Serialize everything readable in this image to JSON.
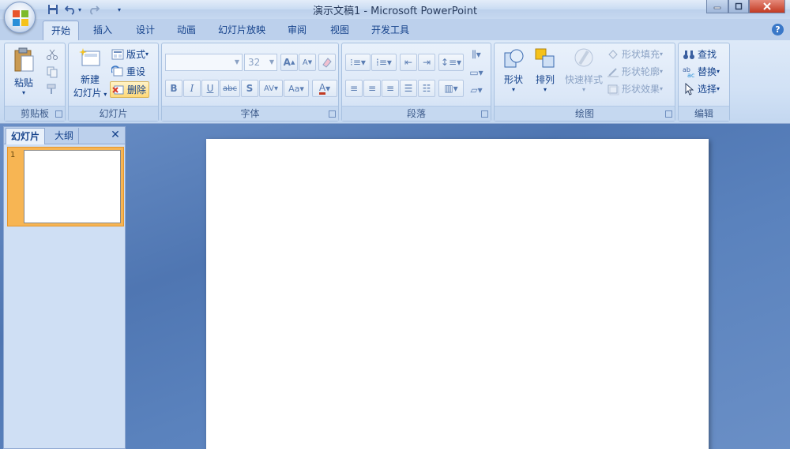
{
  "window": {
    "title": "演示文稿1 - Microsoft PowerPoint",
    "buttons": [
      "minimize",
      "maximize",
      "close"
    ]
  },
  "tabs": [
    {
      "label": "开始",
      "active": true
    },
    {
      "label": "插入"
    },
    {
      "label": "设计"
    },
    {
      "label": "动画"
    },
    {
      "label": "幻灯片放映"
    },
    {
      "label": "审阅"
    },
    {
      "label": "视图"
    },
    {
      "label": "开发工具"
    }
  ],
  "ribbon": {
    "clipboard": {
      "label": "剪贴板",
      "paste": "粘贴"
    },
    "slides": {
      "label": "幻灯片",
      "new_slide_1": "新建",
      "new_slide_2": "幻灯片",
      "layout": "版式",
      "reset": "重设",
      "delete": "删除"
    },
    "font": {
      "label": "字体",
      "font_name": "",
      "font_size": "32"
    },
    "paragraph": {
      "label": "段落"
    },
    "drawing": {
      "label": "绘图",
      "shapes": "形状",
      "arrange": "排列",
      "quick_styles": "快速样式",
      "shape_fill": "形状填充",
      "shape_outline": "形状轮廓",
      "shape_effects": "形状效果"
    },
    "editing": {
      "label": "编辑",
      "find": "查找",
      "replace": "替换",
      "select": "选择"
    }
  },
  "panel": {
    "tab_slides": "幻灯片",
    "tab_outline": "大纲",
    "close": "✕",
    "thumb_number": "1"
  },
  "colors": {
    "accent": "#15428b",
    "selection": "#f7b553",
    "workspace": "#5a7db3"
  }
}
